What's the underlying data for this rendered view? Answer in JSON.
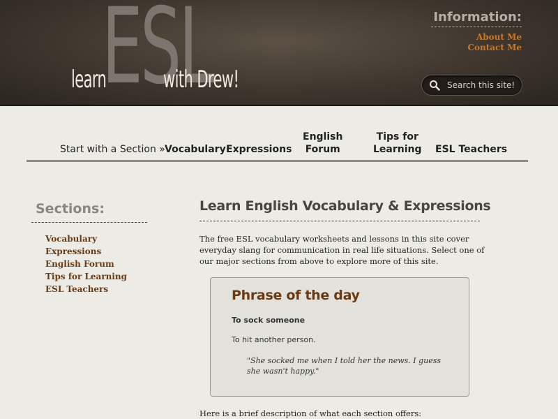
{
  "header": {
    "logo": {
      "learn": "learn",
      "esl": "ESL",
      "drew": "with Drew!"
    },
    "info": {
      "title": "Information:",
      "links": [
        "About Me",
        "Contact Me"
      ]
    },
    "search": {
      "placeholder": "Search this site!",
      "icon": "search-icon"
    }
  },
  "nav": {
    "start": "Start with a Section »",
    "items": [
      {
        "label": "Vocabulary"
      },
      {
        "label": "Expressions"
      },
      {
        "line1": "English",
        "line2": "Forum"
      },
      {
        "line1": "Tips for",
        "line2": "Learning"
      },
      {
        "label": "ESL Teachers"
      }
    ]
  },
  "sidebar": {
    "title": "Sections:",
    "links": [
      "Vocabulary",
      "Expressions",
      "English Forum",
      "Tips for Learning",
      "ESL Teachers"
    ]
  },
  "main": {
    "title": "Learn English Vocabulary & Expressions",
    "intro": "The free ESL vocabulary worksheets and lessons in this site cover everyday slang for communication in real life situations. Select one of our major sections from above to explore more of this site.",
    "phrase": {
      "title": "Phrase of the day",
      "term": "To sock someone",
      "definition": "To hit another person.",
      "example": "\"She socked me when I told her the news. I guess she wasn't happy.\""
    },
    "brief": "Here is a brief description of what each section offers:"
  },
  "colors": {
    "link_orange": "#c8782a",
    "link_brown": "#6a3b12",
    "header_bg": "#3f372e",
    "page_bg": "#ecebe6"
  }
}
